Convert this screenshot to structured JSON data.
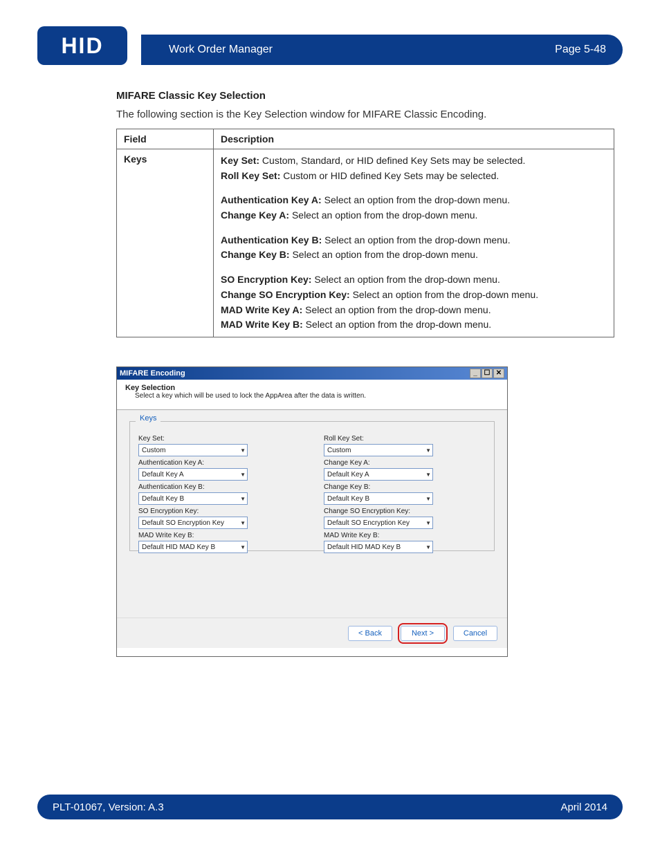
{
  "header": {
    "logo_text": "HID",
    "title": "Work Order Manager",
    "page_label": "Page 5-48"
  },
  "footer": {
    "doc_id": "PLT-01067, Version: A.3",
    "date": "April 2014"
  },
  "section": {
    "heading": "MIFARE Classic Key Selection",
    "intro": "The following section is the Key Selection window for MIFARE Classic Encoding."
  },
  "table": {
    "col_field": "Field",
    "col_description": "Description",
    "row_field": "Keys",
    "blocks": [
      [
        {
          "b": "Key Set:",
          "t": " Custom, Standard, or HID defined Key Sets may be selected."
        },
        {
          "b": "Roll Key Set:",
          "t": " Custom or HID defined Key Sets may be selected."
        }
      ],
      [
        {
          "b": "Authentication Key A:",
          "t": " Select an option from the drop-down menu."
        },
        {
          "b": "Change Key A:",
          "t": " Select an option from the drop-down menu."
        }
      ],
      [
        {
          "b": "Authentication Key B:",
          "t": " Select an option from the drop-down menu."
        },
        {
          "b": "Change Key B:",
          "t": " Select an option from the drop-down menu."
        }
      ],
      [
        {
          "b": "SO Encryption Key:",
          "t": " Select an option from the drop-down menu."
        },
        {
          "b": "Change SO Encryption Key:",
          "t": " Select an option from the drop-down menu."
        },
        {
          "b": "MAD Write Key A:",
          "t": " Select an option from the drop-down menu."
        },
        {
          "b": "MAD Write Key B:",
          "t": " Select an option from the drop-down menu."
        }
      ]
    ]
  },
  "wizard": {
    "window_title": "MIFARE Encoding",
    "controls": {
      "min": "_",
      "max": "☐",
      "close": "✕"
    },
    "head_title": "Key Selection",
    "head_sub": "Select a key which will be used to lock the AppArea after the data is written.",
    "group_label": "Keys",
    "left": [
      {
        "label": "Key Set:",
        "value": "Custom"
      },
      {
        "label": "Authentication Key A:",
        "value": "Default Key A"
      },
      {
        "label": "Authentication Key B:",
        "value": "Default Key B"
      },
      {
        "label": "SO Encryption Key:",
        "value": "Default SO Encryption Key"
      },
      {
        "label": "MAD Write Key B:",
        "value": "Default HID MAD Key B"
      }
    ],
    "right": [
      {
        "label": "Roll Key Set:",
        "value": "Custom"
      },
      {
        "label": "Change Key A:",
        "value": "Default Key A"
      },
      {
        "label": "Change Key B:",
        "value": "Default Key B"
      },
      {
        "label": "Change SO Encryption Key:",
        "value": "Default SO Encryption Key"
      },
      {
        "label": "MAD Write Key B:",
        "value": "Default HID MAD Key B"
      }
    ],
    "buttons": {
      "back": "< Back",
      "next": "Next >",
      "cancel": "Cancel"
    }
  }
}
